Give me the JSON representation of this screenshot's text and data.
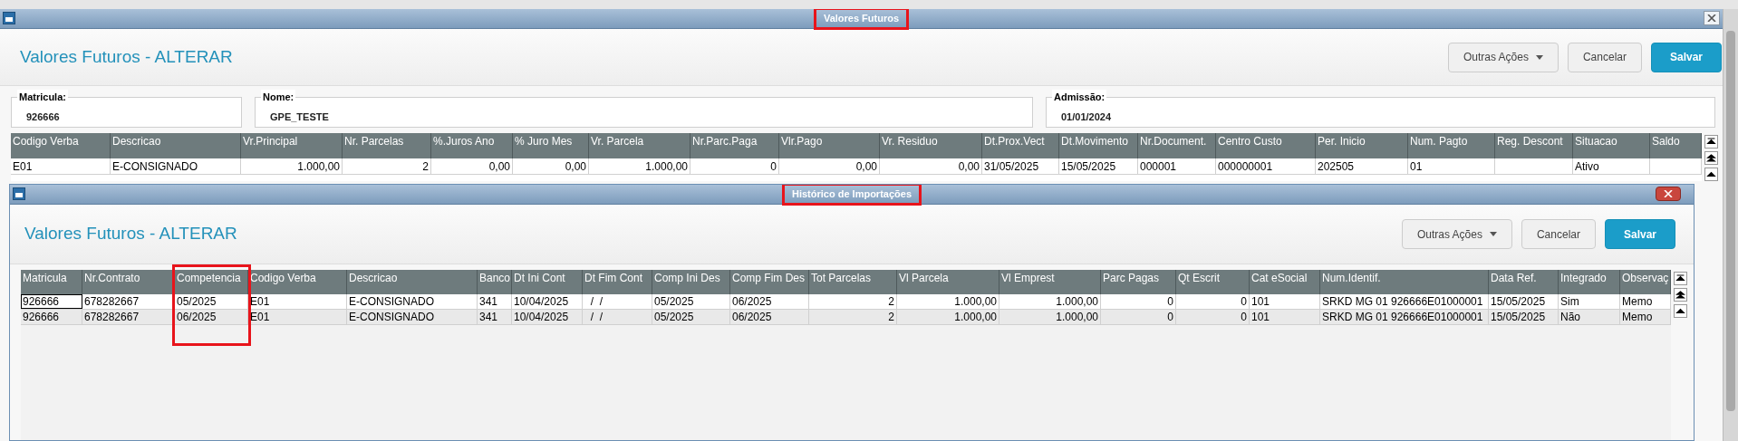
{
  "window": {
    "title": "Valores Futuros",
    "title_highlighted": true,
    "heading": "Valores Futuros - ALTERAR",
    "buttons": [
      {
        "label": "Outras Ações",
        "kind": "menu"
      },
      {
        "label": "Cancelar",
        "kind": "plain"
      },
      {
        "label": "Salvar",
        "kind": "primary"
      }
    ]
  },
  "fields": [
    {
      "label": "Matricula:",
      "value": "926666"
    },
    {
      "label": "Nome:",
      "value": "GPE_TESTE"
    },
    {
      "label": "Admissão:",
      "value": "01/01/2024"
    }
  ],
  "grid": {
    "columns": [
      {
        "label": "Codigo Verba",
        "kind": "text",
        "highlighted": false
      },
      {
        "label": "Descricao",
        "kind": "text",
        "highlighted": false
      },
      {
        "label": "Vr.Principal",
        "kind": "number",
        "highlighted": false
      },
      {
        "label": "Nr. Parcelas",
        "kind": "number",
        "highlighted": false
      },
      {
        "label": "%.Juros Ano",
        "kind": "number",
        "highlighted": false
      },
      {
        "label": "% Juro Mes",
        "kind": "number",
        "highlighted": false
      },
      {
        "label": "Vr. Parcela",
        "kind": "number",
        "highlighted": false
      },
      {
        "label": "Nr.Parc.Paga",
        "kind": "number",
        "highlighted": false
      },
      {
        "label": "Vlr.Pago",
        "kind": "number",
        "highlighted": false
      },
      {
        "label": "Vr. Residuo",
        "kind": "number",
        "highlighted": false
      },
      {
        "label": "Dt.Prox.Vect",
        "kind": "text",
        "highlighted": false
      },
      {
        "label": "Dt.Movimento",
        "kind": "text",
        "highlighted": false
      },
      {
        "label": "Nr.Document.",
        "kind": "text",
        "highlighted": false
      },
      {
        "label": "Centro Custo",
        "kind": "text",
        "highlighted": false
      },
      {
        "label": "Per. Inicio",
        "kind": "text",
        "highlighted": false
      },
      {
        "label": "Num. Pagto",
        "kind": "text",
        "highlighted": false
      },
      {
        "label": "Reg. Descont",
        "kind": "text",
        "highlighted": false
      },
      {
        "label": "Situacao",
        "kind": "text",
        "highlighted": false
      },
      {
        "label": "Saldo",
        "kind": "text",
        "highlighted": false
      }
    ],
    "rows": [
      {
        "focused": false,
        "cells": [
          "E01",
          "E-CONSIGNADO",
          "1.000,00",
          "2",
          "0,00",
          "0,00",
          "1.000,00",
          "0",
          "0,00",
          "0,00",
          "31/05/2025",
          "15/05/2025",
          "000001",
          "000000001",
          "202505",
          "01",
          "",
          "Ativo",
          ""
        ]
      }
    ]
  },
  "dialog": {
    "title": "Histórico de Importações",
    "title_highlighted": true,
    "heading": "Valores Futuros - ALTERAR",
    "buttons": [
      {
        "label": "Outras Ações",
        "kind": "menu"
      },
      {
        "label": "Cancelar",
        "kind": "plain"
      },
      {
        "label": "Salvar",
        "kind": "primary"
      }
    ],
    "grid": {
      "columns": [
        {
          "label": "Matricula",
          "kind": "text",
          "highlighted": false
        },
        {
          "label": "Nr.Contrato",
          "kind": "text",
          "highlighted": false
        },
        {
          "label": "Competencia",
          "kind": "text",
          "highlighted": true
        },
        {
          "label": "Codigo Verba",
          "kind": "text",
          "highlighted": false
        },
        {
          "label": "Descricao",
          "kind": "text",
          "highlighted": false
        },
        {
          "label": "Banco",
          "kind": "text",
          "highlighted": false
        },
        {
          "label": "Dt Ini Cont",
          "kind": "text",
          "highlighted": false
        },
        {
          "label": "Dt Fim Cont",
          "kind": "text",
          "highlighted": false
        },
        {
          "label": "Comp Ini Des",
          "kind": "text",
          "highlighted": false
        },
        {
          "label": "Comp Fim Des",
          "kind": "text",
          "highlighted": false
        },
        {
          "label": "Tot Parcelas",
          "kind": "number",
          "highlighted": false
        },
        {
          "label": "Vl Parcela",
          "kind": "number",
          "highlighted": false
        },
        {
          "label": "Vl Emprest",
          "kind": "number",
          "highlighted": false
        },
        {
          "label": "Parc Pagas",
          "kind": "number",
          "highlighted": false
        },
        {
          "label": "Qt Escrit",
          "kind": "number",
          "highlighted": false
        },
        {
          "label": "Cat eSocial",
          "kind": "text",
          "highlighted": false
        },
        {
          "label": "Num.Identif.",
          "kind": "text",
          "highlighted": false
        },
        {
          "label": "Data Ref.",
          "kind": "text",
          "highlighted": false
        },
        {
          "label": "Integrado",
          "kind": "text",
          "highlighted": false
        },
        {
          "label": "Observaç",
          "kind": "text",
          "highlighted": false
        }
      ],
      "rows": [
        {
          "focused": true,
          "cells": [
            "926666",
            "678282667",
            "05/2025",
            "E01",
            "E-CONSIGNADO",
            "341",
            "10/04/2025",
            "  /  /",
            "05/2025",
            "06/2025",
            "2",
            "1.000,00",
            "1.000,00",
            "0",
            "0",
            "101",
            "SRKD MG 01 926666E01000001",
            "15/05/2025",
            "Sim",
            "Memo"
          ]
        },
        {
          "focused": false,
          "cells": [
            "926666",
            "678282667",
            "06/2025",
            "E01",
            "E-CONSIGNADO",
            "341",
            "10/04/2025",
            "  /  /",
            "05/2025",
            "06/2025",
            "2",
            "1.000,00",
            "1.000,00",
            "0",
            "0",
            "101",
            "SRKD MG 01 926666E01000001",
            "15/05/2025",
            "Não",
            "Memo"
          ]
        }
      ]
    }
  }
}
